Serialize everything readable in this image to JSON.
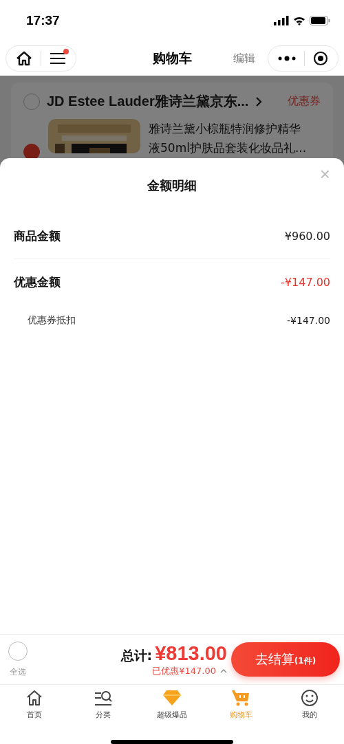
{
  "status_bar": {
    "time": "17:37"
  },
  "nav": {
    "title": "购物车",
    "edit": "编辑",
    "menu_badge": true
  },
  "cart": {
    "shop": {
      "name": "JD Estee Lauder雅诗兰黛京东...",
      "checked": false,
      "coupon": "优惠券"
    },
    "item": {
      "title": "雅诗兰黛小棕瓶特润修护精华液50ml护肤品套装化妆品礼...",
      "checked": true
    }
  },
  "sheet": {
    "title": "金额明细",
    "close": "×",
    "rows": [
      {
        "kind": "main",
        "label": "商品金额",
        "value": "¥960.00",
        "discount": false
      },
      {
        "kind": "main",
        "label": "优惠金额",
        "value": "-¥147.00",
        "discount": true
      },
      {
        "kind": "sub",
        "label": "优惠券抵扣",
        "value": "-¥147.00",
        "discount": false
      }
    ]
  },
  "checkout": {
    "select_all": {
      "label": "全选",
      "checked": false
    },
    "total_label": "总计:",
    "total": "¥813.00",
    "saved": "已优惠¥147.00",
    "expanded": true,
    "button": "去结算",
    "count": "(1件)"
  },
  "tabs": [
    {
      "label": "首页",
      "kind": "home",
      "selected": false
    },
    {
      "label": "分类",
      "kind": "category",
      "selected": false
    },
    {
      "label": "超级爆品",
      "kind": "diamond",
      "selected": false
    },
    {
      "label": "购物车",
      "kind": "cart",
      "selected": true
    },
    {
      "label": "我的",
      "kind": "smile",
      "selected": false
    }
  ]
}
